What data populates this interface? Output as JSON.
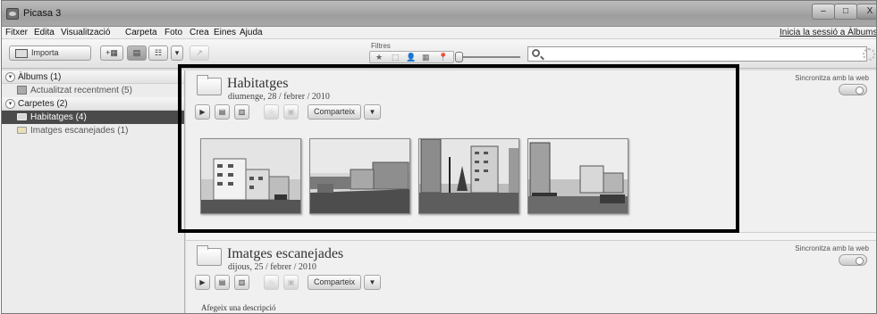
{
  "window": {
    "title": "Picasa 3"
  },
  "window_controls": {
    "minimize": "–",
    "maximize": "□",
    "close": "X"
  },
  "menu": {
    "items": [
      "Fitxer",
      "Edita",
      "Visualització",
      "Carpeta",
      "Foto",
      "Crea",
      "Eines",
      "Ajuda"
    ],
    "signin": "Inicia la sessió a Àlbums web"
  },
  "toolbar": {
    "import_label": "Importa",
    "filters_label": "Filtres",
    "filter_icons": [
      "★",
      "⬚",
      "👤",
      "▦",
      "📍"
    ],
    "search_value": ""
  },
  "sidebar": {
    "albums": {
      "toggle": "▾",
      "label": "Àlbums (1)",
      "items": [
        "Actualitzat recentment (5)"
      ]
    },
    "folders": {
      "toggle": "▾",
      "label": "Carpetes (2)",
      "items": [
        "Habitatges (4)",
        "Imatges escanejades (1)"
      ]
    },
    "selected": "Habitatges (4)"
  },
  "albums": [
    {
      "title": "Habitatges",
      "date": "diumenge, 28 / febrer / 2010",
      "share_label": "Comparteix",
      "sync_label": "Sincronitza amb la web",
      "photo_count": 4
    },
    {
      "title": "Imatges escanejades",
      "date": "dijous, 25 / febrer / 2010",
      "share_label": "Comparteix",
      "sync_label": "Sincronitza amb la web",
      "description": "Afegeix una descripció"
    }
  ],
  "action_buttons": {
    "play": "▶",
    "collage": "▤",
    "movie": "▥",
    "star": "☆",
    "save": "▣",
    "dropdown": "▼"
  },
  "colors": {
    "selected_bg": "#4a4a4a",
    "highlight": "#000000"
  },
  "icons": {
    "app": "picasa-icon",
    "search": "search-icon",
    "folder": "folder-icon",
    "spinner": "spinner-icon"
  }
}
